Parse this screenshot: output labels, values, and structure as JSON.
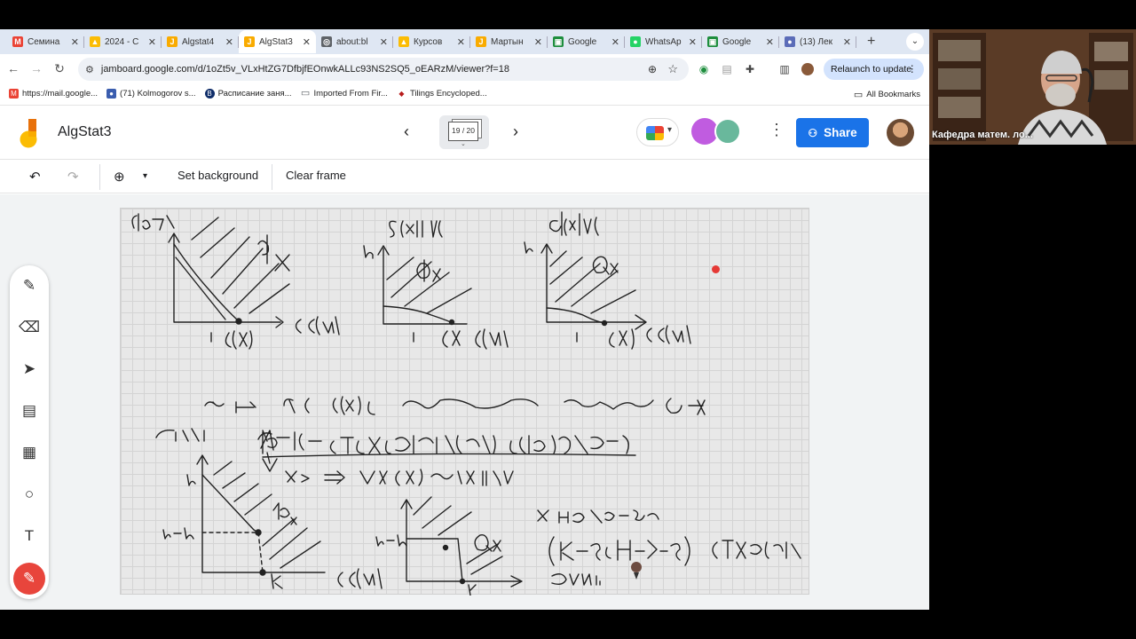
{
  "tabs": [
    {
      "label": "Семина",
      "icon": "gmail-icon",
      "color": "#ea4335",
      "glyph": "M"
    },
    {
      "label": "2024 - С",
      "icon": "drive-icon",
      "color": "#fbbc04",
      "glyph": "▲"
    },
    {
      "label": "Algstat4",
      "icon": "jamboard-icon",
      "color": "#f9ab00",
      "glyph": "J"
    },
    {
      "label": "AlgStat3",
      "icon": "jamboard-icon",
      "color": "#f9ab00",
      "glyph": "J"
    },
    {
      "label": "about:bl",
      "icon": "globe-icon",
      "color": "#5f6368",
      "glyph": "◎"
    },
    {
      "label": "Курсов",
      "icon": "drive-icon",
      "color": "#fbbc04",
      "glyph": "▲"
    },
    {
      "label": "Мартын",
      "icon": "jamboard-icon",
      "color": "#f9ab00",
      "glyph": "J"
    },
    {
      "label": "Google",
      "icon": "classroom-icon",
      "color": "#1e8e3e",
      "glyph": "▣"
    },
    {
      "label": "WhatsAp",
      "icon": "whatsapp-icon",
      "color": "#25d366",
      "glyph": "●"
    },
    {
      "label": "Google",
      "icon": "classroom-icon",
      "color": "#1e8e3e",
      "glyph": "▣"
    },
    {
      "label": "(13) Лек",
      "icon": "person-icon",
      "color": "#5b6cb8",
      "glyph": "●"
    }
  ],
  "active_tab_index": 3,
  "address": {
    "url": "jamboard.google.com/d/1oZt5v_VLxHtZG7DfbjfEOnwkALLc93NS2SQ5_oEARzM/viewer?f=18",
    "relaunch_label": "Relaunch to update"
  },
  "bookmarks": [
    {
      "label": "https://mail.google...",
      "icon": "gmail-icon",
      "color": "#ea4335",
      "glyph": "M"
    },
    {
      "label": "(71) Kolmogorov s...",
      "icon": "person-icon",
      "color": "#3a5dae",
      "glyph": "●"
    },
    {
      "label": "Расписание заня...",
      "icon": "hse-icon",
      "color": "#0f2d69",
      "glyph": "B"
    },
    {
      "label": "Imported From Fir...",
      "icon": "folder-icon",
      "color": "#5f6368",
      "glyph": "▭"
    },
    {
      "label": "Tilings Encycloped...",
      "icon": "tiling-icon",
      "color": "#b71c1c",
      "glyph": "◆"
    }
  ],
  "all_bookmarks_label": "All Bookmarks",
  "jamboard": {
    "title": "AlgStat3",
    "frame_indicator": "19 / 20",
    "share_label": "Share"
  },
  "jam_toolbar": {
    "set_background": "Set background",
    "clear_frame": "Clear frame"
  },
  "webcam": {
    "label": "Кафедра матем. ло..."
  }
}
